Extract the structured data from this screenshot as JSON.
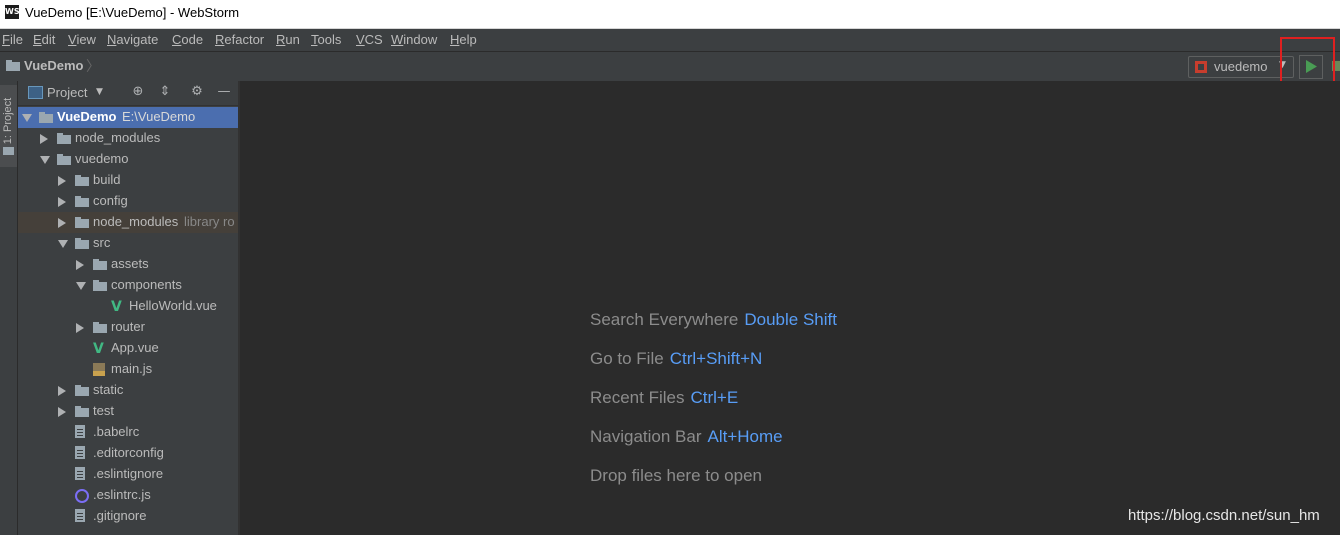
{
  "window": {
    "logo_text": "WS",
    "title": "VueDemo [E:\\VueDemo] - WebStorm"
  },
  "menu": [
    {
      "mnemonic": "F",
      "rest": "ile"
    },
    {
      "mnemonic": "E",
      "rest": "dit"
    },
    {
      "mnemonic": "V",
      "rest": "iew"
    },
    {
      "mnemonic": "N",
      "rest": "avigate"
    },
    {
      "mnemonic": "C",
      "rest": "ode"
    },
    {
      "mnemonic": "R",
      "rest": "efactor"
    },
    {
      "mnemonic": "R",
      "rest": "un"
    },
    {
      "mnemonic": "T",
      "rest": "ools"
    },
    {
      "mnemonic": "V",
      "rest": "CS"
    },
    {
      "mnemonic": "W",
      "rest": "indow"
    },
    {
      "mnemonic": "H",
      "rest": "elp"
    }
  ],
  "navbar": {
    "project_name": "VueDemo",
    "run_config": "vuedemo",
    "run_config_arrow": "▼"
  },
  "side_tab": {
    "label": "1: Project"
  },
  "project_panel": {
    "title": "Project",
    "dropdown_arrow": "▼",
    "tools": {
      "locate": "⊕",
      "collapse": "⇕",
      "settings": "⚙",
      "hide": "—"
    },
    "tree": [
      {
        "label": "VueDemo",
        "extra": "E:\\VueDemo",
        "arrow": "down",
        "icon": "folder-icon",
        "depth": 0,
        "bold": true,
        "selected": true
      },
      {
        "label": "node_modules",
        "extra": "",
        "arrow": "right",
        "icon": "folder-icon",
        "depth": 1
      },
      {
        "label": "vuedemo",
        "extra": "",
        "arrow": "down",
        "icon": "folder-icon",
        "depth": 1
      },
      {
        "label": "build",
        "extra": "",
        "arrow": "right",
        "icon": "folder-icon",
        "depth": 2
      },
      {
        "label": "config",
        "extra": "",
        "arrow": "right",
        "icon": "folder-icon",
        "depth": 2
      },
      {
        "label": "node_modules",
        "extra": "library ro",
        "arrow": "right",
        "icon": "folder-icon",
        "depth": 2,
        "lib": true
      },
      {
        "label": "src",
        "extra": "",
        "arrow": "down",
        "icon": "folder-icon",
        "depth": 2
      },
      {
        "label": "assets",
        "extra": "",
        "arrow": "right",
        "icon": "folder-icon",
        "depth": 3
      },
      {
        "label": "components",
        "extra": "",
        "arrow": "down",
        "icon": "folder-icon",
        "depth": 3
      },
      {
        "label": "HelloWorld.vue",
        "extra": "",
        "arrow": "",
        "icon": "vue-file-icon",
        "depth": 4
      },
      {
        "label": "router",
        "extra": "",
        "arrow": "right",
        "icon": "folder-icon",
        "depth": 3
      },
      {
        "label": "App.vue",
        "extra": "",
        "arrow": "",
        "icon": "vue-file-icon",
        "depth": 3
      },
      {
        "label": "main.js",
        "extra": "",
        "arrow": "",
        "icon": "js-file-icon",
        "depth": 3
      },
      {
        "label": "static",
        "extra": "",
        "arrow": "right",
        "icon": "folder-icon",
        "depth": 2
      },
      {
        "label": "test",
        "extra": "",
        "arrow": "right",
        "icon": "folder-icon",
        "depth": 2
      },
      {
        "label": ".babelrc",
        "extra": "",
        "arrow": "",
        "icon": "babel-file-icon",
        "depth": 2
      },
      {
        "label": ".editorconfig",
        "extra": "",
        "arrow": "",
        "icon": "text-file-icon",
        "depth": 2
      },
      {
        "label": ".eslintignore",
        "extra": "",
        "arrow": "",
        "icon": "text-file-icon",
        "depth": 2
      },
      {
        "label": ".eslintrc.js",
        "extra": "",
        "arrow": "",
        "icon": "eslint-file-icon",
        "depth": 2
      },
      {
        "label": ".gitignore",
        "extra": "",
        "arrow": "",
        "icon": "text-file-icon",
        "depth": 2
      }
    ]
  },
  "editor": {
    "hints": [
      {
        "label": "Search Everywhere",
        "key": "Double Shift"
      },
      {
        "label": "Go to File",
        "key": "Ctrl+Shift+N"
      },
      {
        "label": "Recent Files",
        "key": "Ctrl+E"
      },
      {
        "label": "Navigation Bar",
        "key": "Alt+Home"
      },
      {
        "label": "Drop files here to open",
        "key": ""
      }
    ]
  },
  "watermark": "https://blog.csdn.net/sun_hm",
  "colors": {
    "background": "#2b2b2b",
    "panel": "#3c3f41",
    "selection": "#4b6eaf",
    "shortcut": "#589df6",
    "highlight_box": "#e02020",
    "run_green": "#499c54",
    "vue_green": "#41b883"
  }
}
